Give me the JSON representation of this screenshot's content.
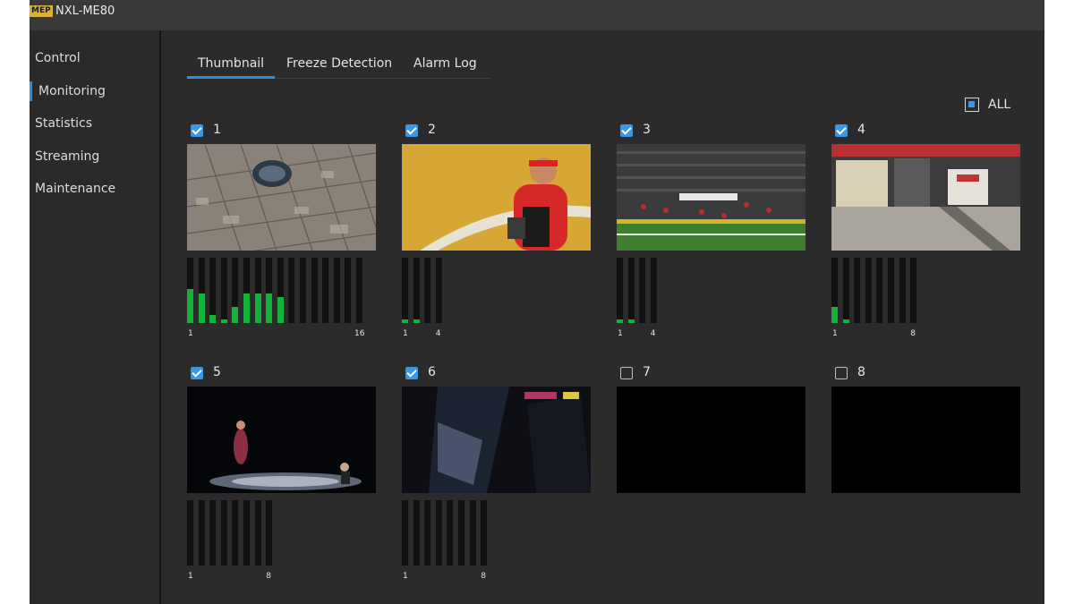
{
  "app": {
    "logo": "MEP",
    "title": "NXL-ME80"
  },
  "sidebar": {
    "items": [
      {
        "label": "Control",
        "active": false
      },
      {
        "label": "Monitoring",
        "active": true
      },
      {
        "label": "Statistics",
        "active": false
      },
      {
        "label": "Streaming",
        "active": false
      },
      {
        "label": "Maintenance",
        "active": false
      }
    ]
  },
  "tabs": [
    {
      "label": "Thumbnail",
      "active": true
    },
    {
      "label": "Freeze Detection",
      "active": false
    },
    {
      "label": "Alarm Log",
      "active": false
    }
  ],
  "select_all": {
    "label": "ALL",
    "state": "partial"
  },
  "colors": {
    "accent": "#2f8ee0",
    "meter_fill": "#13b23a",
    "meter_bg": "#111111"
  },
  "channels": [
    {
      "id": "1",
      "checked": true,
      "scene": "aerial-stadium",
      "meter": {
        "count": 16,
        "first_label": "1",
        "last_label": "16",
        "levels": [
          0.52,
          0.45,
          0.12,
          0.05,
          0.24,
          0.45,
          0.45,
          0.45,
          0.4,
          0,
          0,
          0,
          0,
          0,
          0,
          0
        ]
      }
    },
    {
      "id": "2",
      "checked": true,
      "scene": "player-close-up",
      "meter": {
        "count": 4,
        "first_label": "1",
        "last_label": "4",
        "levels": [
          0.05,
          0.05,
          0,
          0
        ]
      }
    },
    {
      "id": "3",
      "checked": true,
      "scene": "stadium-field",
      "meter": {
        "count": 4,
        "first_label": "1",
        "last_label": "4",
        "levels": [
          0.05,
          0.05,
          0,
          0
        ]
      }
    },
    {
      "id": "4",
      "checked": true,
      "scene": "stadium-tunnel",
      "meter": {
        "count": 8,
        "first_label": "1",
        "last_label": "8",
        "levels": [
          0.24,
          0.05,
          0,
          0,
          0,
          0,
          0,
          0
        ]
      }
    },
    {
      "id": "5",
      "checked": true,
      "scene": "stage-performance",
      "meter": {
        "count": 8,
        "first_label": "1",
        "last_label": "8",
        "levels": [
          0,
          0,
          0,
          0,
          0,
          0,
          0,
          0
        ]
      }
    },
    {
      "id": "6",
      "checked": true,
      "scene": "dark-interior",
      "meter": {
        "count": 8,
        "first_label": "1",
        "last_label": "8",
        "levels": [
          0,
          0,
          0,
          0,
          0,
          0,
          0,
          0
        ]
      }
    },
    {
      "id": "7",
      "checked": false,
      "scene": "no-signal",
      "meter": null
    },
    {
      "id": "8",
      "checked": false,
      "scene": "no-signal",
      "meter": null
    }
  ]
}
